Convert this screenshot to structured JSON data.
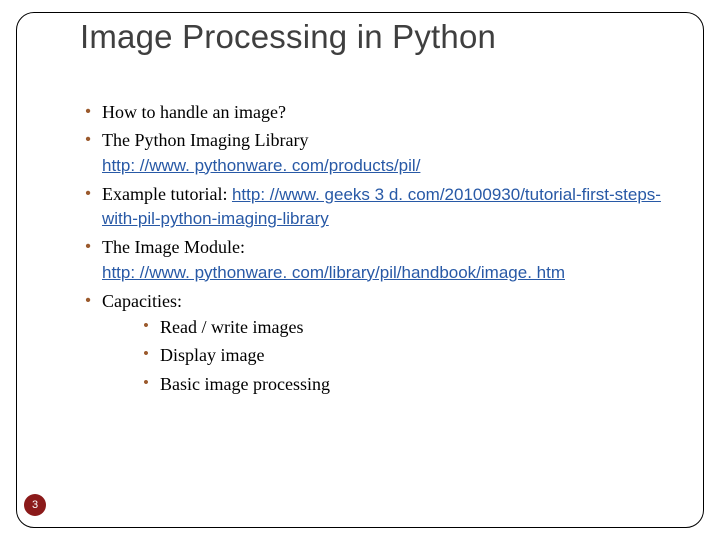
{
  "title": "Image Processing in Python",
  "bullets": {
    "b1": "How to handle an image?",
    "b2_text": "The Python Imaging Library",
    "b2_link": "http: //www. pythonware. com/products/pil/",
    "b3_text": "Example tutorial: ",
    "b3_link": "http: //www. geeks 3 d. com/20100930/tutorial-first-steps-with-pil-python-imaging-library",
    "b4_text": "The Image Module:",
    "b4_link": "http: //www. pythonware. com/library/pil/handbook/image. htm",
    "b5_text": "Capacities:",
    "sub1": "Read / write images",
    "sub2": "Display image",
    "sub3": "Basic image processing"
  },
  "page_number": "3"
}
